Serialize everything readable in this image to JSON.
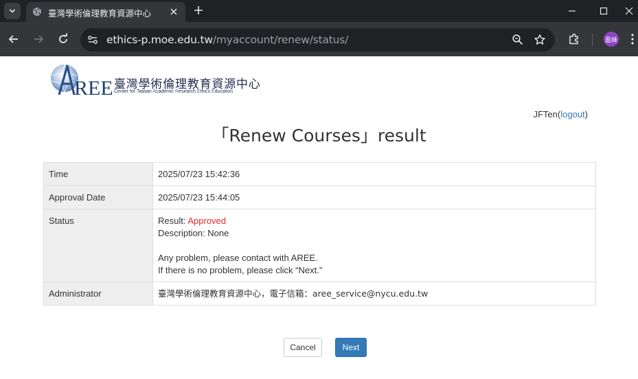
{
  "browser": {
    "tab_title": "臺灣學術倫理教育資源中心",
    "url_host": "ethics-p.moe.edu.tw",
    "url_path": "/myaccount/renew/status/",
    "profile_initials": "盈妹",
    "profile_color": "#8e44c4"
  },
  "logo": {
    "mark": "AREE",
    "name_cn": "臺灣學術倫理教育資源中心",
    "name_en_parts": [
      "Center for Taiwan ",
      "A",
      "cademic ",
      "R",
      "esearch ",
      "E",
      "thics ",
      "E",
      "ducation"
    ]
  },
  "user": {
    "name": "JFTen",
    "open_paren": "(",
    "logout_label": "logout",
    "close_paren": ")"
  },
  "page": {
    "title": "「Renew Courses」result"
  },
  "details": {
    "time_label": "Time",
    "time_value": "2025/07/23 15:42:36",
    "approval_label": "Approval Date",
    "approval_value": "2025/07/23 15:44:05",
    "status_label": "Status",
    "result_prefix": "Result: ",
    "result_value": "Approved",
    "description": "Description: None",
    "contact_line": "Any problem, please contact with AREE.",
    "next_line": "If there is no problem, please click “Next.”",
    "admin_label": "Administrator",
    "admin_value": "臺灣學術倫理教育資源中心，電子信箱：aree_service@nycu.edu.tw"
  },
  "buttons": {
    "cancel_label": "Cancel",
    "next_label": "Next"
  },
  "colors": {
    "approved": "#e4282e",
    "link": "#337ab7",
    "primary_button": "#337ab7",
    "label_cell_bg": "#eeeeee"
  }
}
